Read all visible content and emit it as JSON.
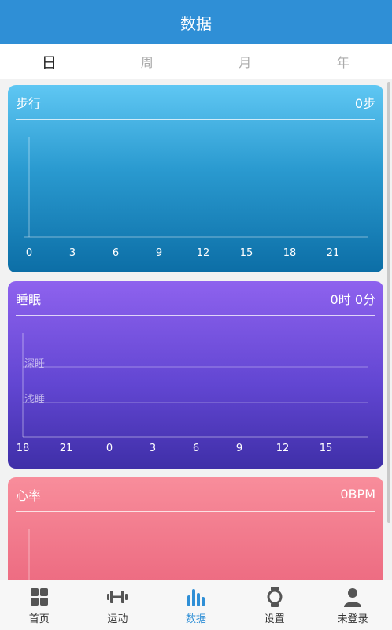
{
  "header": {
    "title": "数据"
  },
  "tabs": [
    {
      "label": "日",
      "active": true
    },
    {
      "label": "周",
      "active": false
    },
    {
      "label": "月",
      "active": false
    },
    {
      "label": "年",
      "active": false
    }
  ],
  "steps_card": {
    "title": "步行",
    "value": "0步",
    "x_ticks": [
      "0",
      "3",
      "6",
      "9",
      "12",
      "15",
      "18",
      "21"
    ]
  },
  "sleep_card": {
    "title": "睡眠",
    "value": "0时 0分",
    "levels": [
      "深睡",
      "浅睡"
    ],
    "x_ticks": [
      "18",
      "21",
      "0",
      "3",
      "6",
      "9",
      "12",
      "15"
    ]
  },
  "heart_card": {
    "title": "心率",
    "value": "0BPM"
  },
  "bottom_nav": [
    {
      "label": "首页",
      "icon": "grid-icon",
      "active": false
    },
    {
      "label": "运动",
      "icon": "dumbbell-icon",
      "active": false
    },
    {
      "label": "数据",
      "icon": "bar-chart-icon",
      "active": true
    },
    {
      "label": "设置",
      "icon": "watch-icon",
      "active": false
    },
    {
      "label": "未登录",
      "icon": "user-icon",
      "active": false
    }
  ],
  "colors": {
    "header": "#2f8fd6",
    "steps_top": "#5fc7f3",
    "steps_bottom": "#0c6ea6",
    "sleep_top": "#8e62ee",
    "sleep_bottom": "#3f2fa8",
    "heart_top": "#f88d9b",
    "heart_bottom": "#e85f78",
    "nav_active": "#2f8fd6"
  }
}
